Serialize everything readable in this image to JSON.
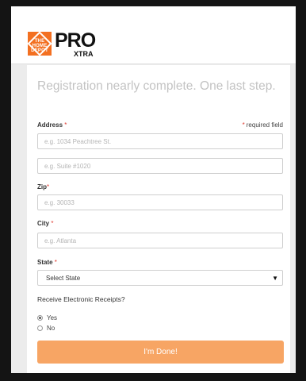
{
  "brand": {
    "mark_text": "THE HOME DEPOT",
    "name": "PRO",
    "tagline": "XTRA",
    "mark_color": "#f37021"
  },
  "form": {
    "subtitle": "Registration nearly complete. One last step.",
    "required_note": "required field",
    "required_marker": "*",
    "address": {
      "label": "Address",
      "line1_placeholder": "e.g. 1034 Peachtree St.",
      "line2_placeholder": "e.g. Suite #1020"
    },
    "zip": {
      "label": "Zip",
      "placeholder": "e.g. 30033"
    },
    "city": {
      "label": "City",
      "placeholder": "e.g. Atlanta"
    },
    "state": {
      "label": "State",
      "selected": "Select State",
      "caret_icon": "▼"
    },
    "receipts": {
      "question": "Receive Electronic Receipts?",
      "options": [
        {
          "label": "Yes",
          "checked": true
        },
        {
          "label": "No",
          "checked": false
        }
      ]
    },
    "submit_label": "I'm Done!",
    "submit_color": "#f7a564"
  }
}
